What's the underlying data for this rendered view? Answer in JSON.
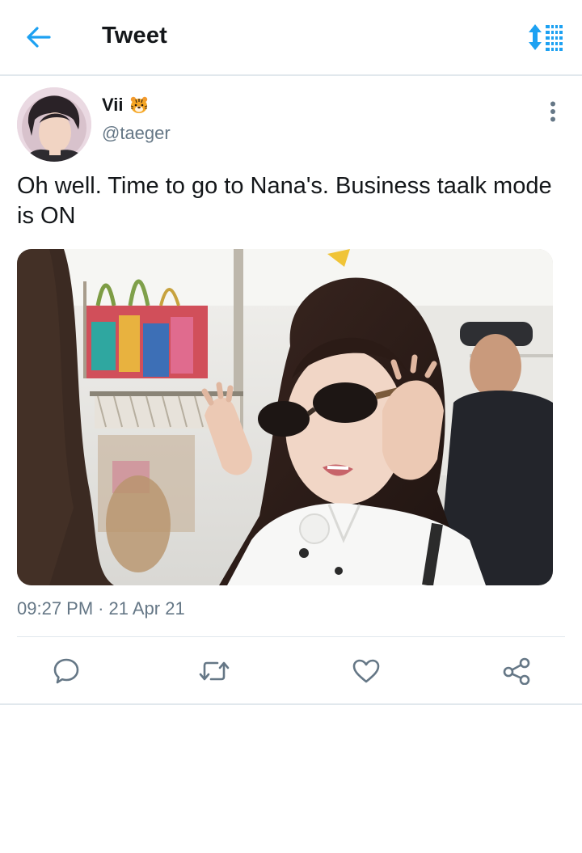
{
  "header": {
    "title": "Tweet",
    "back_icon": "arrow-left-icon",
    "sort_icon": "sort-arrows-list-icon",
    "accent_color": "#1da1f2"
  },
  "tweet": {
    "author_name": "Vii",
    "author_badge_icon": "tiger-face-emoji",
    "author_handle": "@taeger",
    "more_icon": "more-vertical-icon",
    "text": "Oh well. Time to go to Nana's. Business taalk mode is ON",
    "time": "09:27 PM",
    "separator": "·",
    "date": "21 Apr 21"
  },
  "actions": [
    {
      "name": "reply",
      "icon": "comment-icon"
    },
    {
      "name": "retweet",
      "icon": "retweet-icon"
    },
    {
      "name": "like",
      "icon": "heart-icon"
    },
    {
      "name": "share",
      "icon": "share-icon"
    }
  ],
  "colors": {
    "text_primary": "#14171a",
    "text_secondary": "#657786",
    "divider": "#e1e8ed",
    "action_icon": "#657786"
  }
}
